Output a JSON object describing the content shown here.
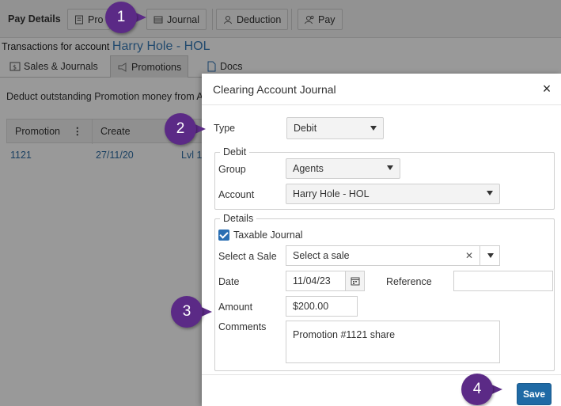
{
  "header": {
    "title": "Pay Details",
    "buttons": {
      "promotions": "Pro",
      "journal": "Journal",
      "deduction": "Deduction",
      "pay": "Pay"
    }
  },
  "account": {
    "prefix": "Transactions for account",
    "name": "Harry Hole - HOL"
  },
  "tabs": [
    "Sales & Journals",
    "Promotions",
    "Docs"
  ],
  "main": {
    "deduct_text": "Deduct outstanding Promotion money from A",
    "columns": [
      "Promotion",
      "Create"
    ],
    "row": [
      "1121",
      "27/11/20",
      "Lvl 1"
    ]
  },
  "modal": {
    "title": "Clearing Account Journal",
    "close": "×",
    "type_label": "Type",
    "type_value": "Debit",
    "debit_legend": "Debit",
    "group_label": "Group",
    "group_value": "Agents",
    "account_label": "Account",
    "account_value": "Harry Hole - HOL",
    "details_legend": "Details",
    "taxable_label": "Taxable Journal",
    "taxable_checked": true,
    "sale_label": "Select a Sale",
    "sale_placeholder": "Select a sale",
    "clear_glyph": "✕",
    "date_label": "Date",
    "date_value": "11/04/23",
    "reference_label": "Reference",
    "reference_value": "",
    "amount_label": "Amount",
    "amount_value": "$200.00",
    "comments_label": "Comments",
    "comments_value": "Promotion #1121 share",
    "save_label": "Save"
  },
  "callouts": [
    "1",
    "2",
    "3",
    "4"
  ],
  "colors": {
    "accent": "#1f6aa5",
    "callout": "#5b2a86",
    "link": "#3a7cb8"
  }
}
